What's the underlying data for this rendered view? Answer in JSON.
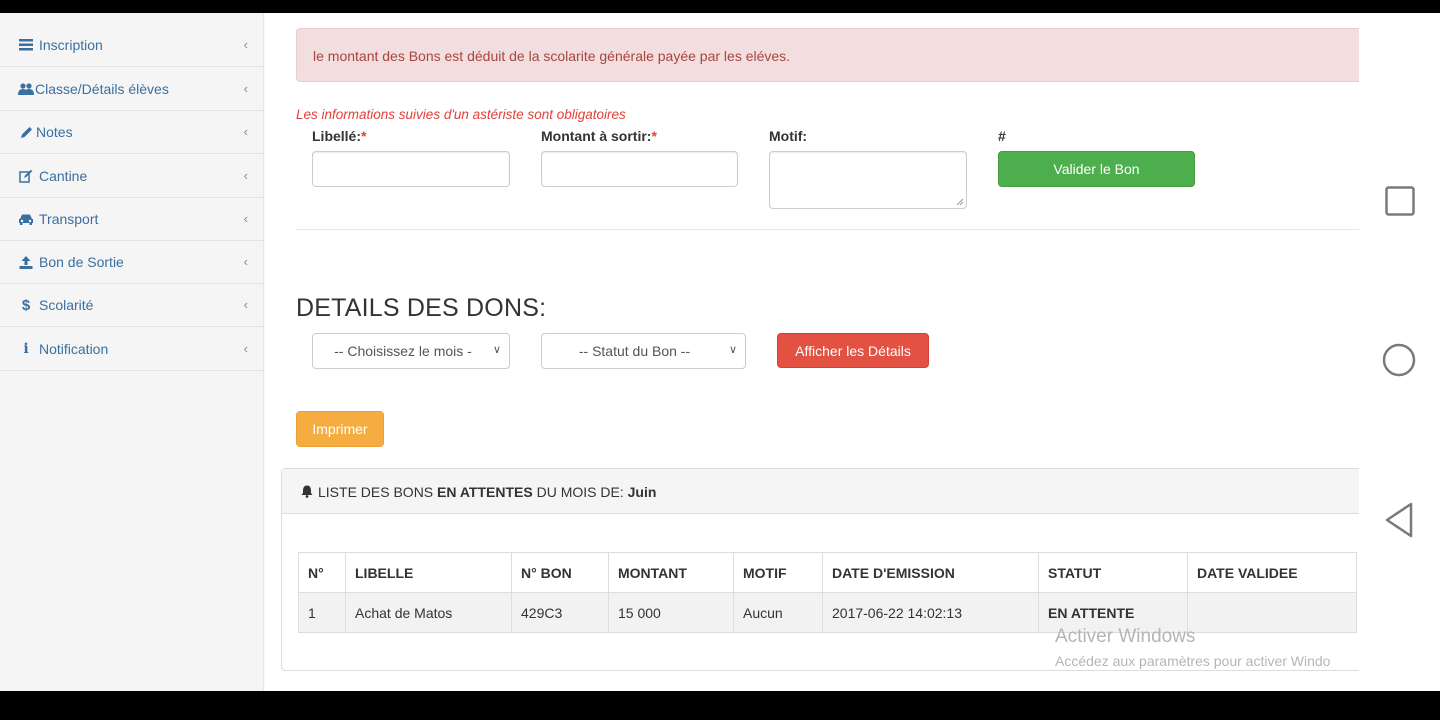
{
  "sidebar": {
    "items": [
      {
        "label": "Inscription",
        "icon": "list-icon"
      },
      {
        "label": "Classe/Détails élèves",
        "icon": "users-icon"
      },
      {
        "label": "Notes",
        "icon": "pencil-icon"
      },
      {
        "label": "Cantine",
        "icon": "edit-icon"
      },
      {
        "label": "Transport",
        "icon": "car-icon"
      },
      {
        "label": "Bon de Sortie",
        "icon": "upload-icon"
      },
      {
        "label": "Scolarité",
        "icon": "dollar-icon"
      },
      {
        "label": "Notification",
        "icon": "info-icon"
      }
    ]
  },
  "alert": "le montant des Bons est déduit de la scolarite générale payée par les eléves.",
  "form": {
    "required_note": "Les informations suivies d'un astériste sont obligatoires",
    "libelle_label": "Libellé:",
    "montant_label": "Montant à sortir:",
    "motif_label": "Motif:",
    "hash_label": "#",
    "required_mark": "*",
    "submit_label": "Valider le Bon"
  },
  "details": {
    "title": "DETAILS DES DONS:",
    "month_select": "-- Choisissez le mois -",
    "status_select": "-- Statut du Bon --",
    "show_button": "Afficher les Détails",
    "print_button": "Imprimer"
  },
  "panel": {
    "heading_prefix": "LISTE DES BONS ",
    "heading_bold": "EN ATTENTES",
    "heading_middle": " DU MOIS DE: ",
    "heading_month": "Juin"
  },
  "table": {
    "headers": [
      "N°",
      "LIBELLE",
      "N° BON",
      "MONTANT",
      "MOTIF",
      "DATE D'EMISSION",
      "STATUT",
      "DATE VALIDEE"
    ],
    "rows": [
      [
        "1",
        "Achat de Matos",
        "429C3",
        "15 000",
        "Aucun",
        "2017-06-22 14:02:13",
        "EN ATTENTE",
        ""
      ]
    ]
  },
  "watermark": {
    "line1": "Activer Windows",
    "line2": "Accédez aux paramètres pour activer Windo"
  },
  "colors": {
    "link": "#3b6fa0",
    "success": "#4cae4c",
    "danger": "#e25141",
    "warning": "#f5ad42",
    "alert_bg": "#f2dede"
  }
}
